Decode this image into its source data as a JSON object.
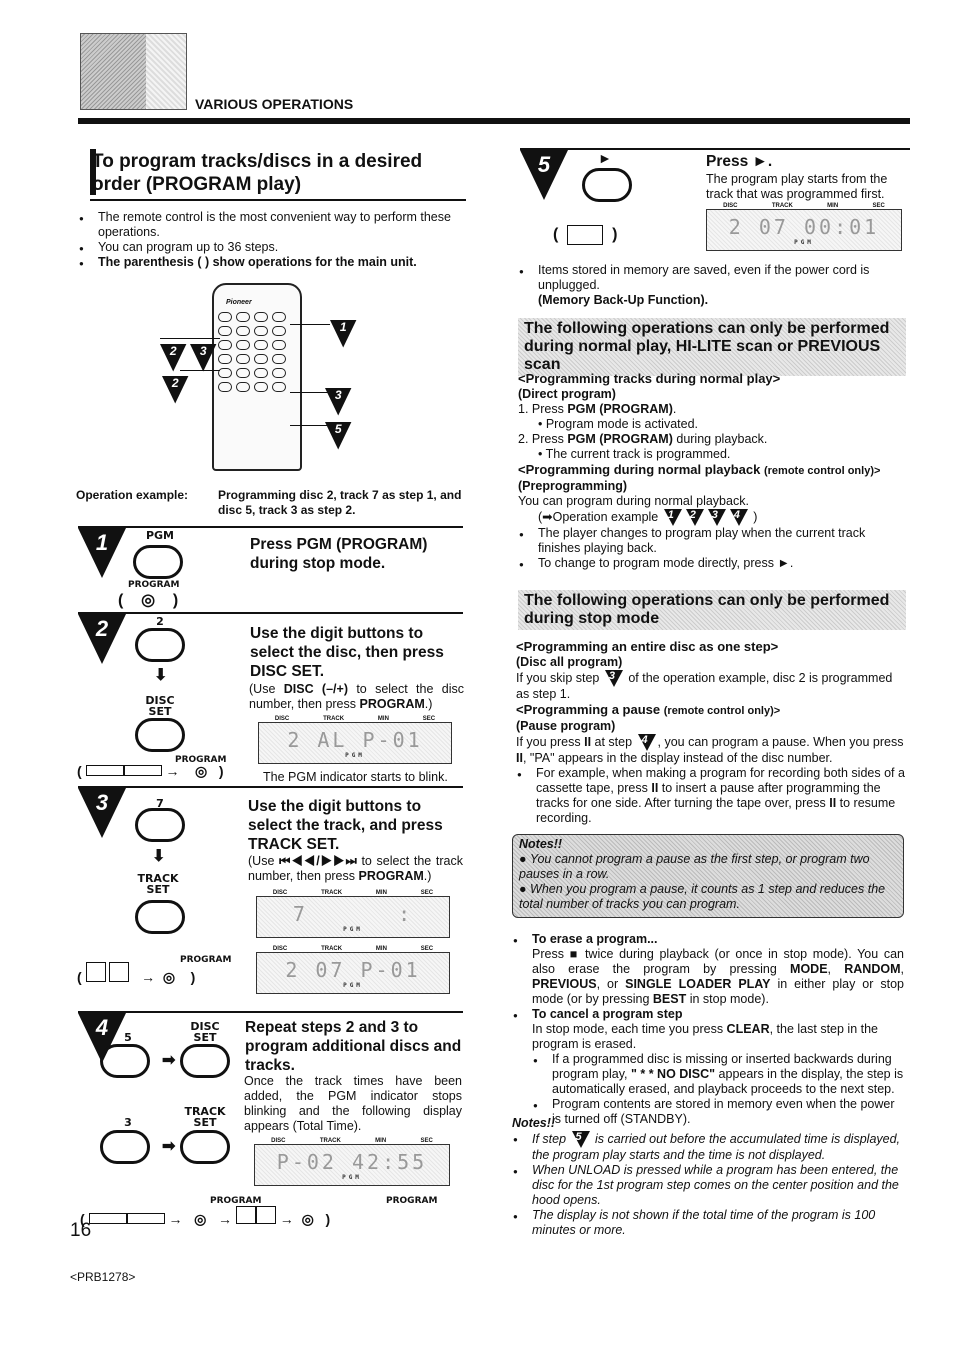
{
  "header": {
    "section": "VARIOUS OPERATIONS"
  },
  "title": {
    "line1": "To program tracks/discs in a desired",
    "line2": "order (PROGRAM play)"
  },
  "intro": [
    "The remote control is the most convenient way to perform these operations.",
    "You can program up to 36 steps.",
    "The parenthesis (   ) show operations for the main unit."
  ],
  "remote": {
    "brand": "Pioneer",
    "step_markers": [
      "1",
      "2",
      "3",
      "2",
      "3",
      "5"
    ]
  },
  "operation_example": {
    "label": "Operation example:",
    "text": "Programming disc 2, track 7 as step 1, and disc 5, track 3 as step 2."
  },
  "step1": {
    "num": "1",
    "key": "PGM",
    "unit_key": "PROGRAM",
    "heading": "Press PGM (PROGRAM) during stop mode."
  },
  "step2": {
    "num": "2",
    "digit": "2",
    "set_key": "DISC SET",
    "disc_key": "DISC",
    "unit_key": "PROGRAM",
    "heading": "Use the digit buttons to select the disc, then press DISC SET.",
    "note": [
      {
        "t": "(Use "
      },
      {
        "t": "DISC (–/+)",
        "b": 1
      },
      {
        "t": " to select the disc number, then press "
      },
      {
        "t": "PROGRAM",
        "b": 1
      },
      {
        "t": ".)"
      }
    ],
    "display": {
      "labels": [
        "DISC",
        "TRACK",
        "MIN",
        "SEC"
      ],
      "text": "2 AL  P-01",
      "indicator": "PGM"
    },
    "caption": "The PGM indicator starts to blink."
  },
  "step3": {
    "num": "3",
    "digit": "7",
    "set_key": "TRACK SET",
    "unit_key": "PROGRAM",
    "heading": "Use the digit buttons to select the track, and press TRACK SET.",
    "note": [
      {
        "t": "(Use "
      },
      {
        "t": "⏮◀◀/▶▶⏭",
        "b": 1
      },
      {
        "t": " to select the track number, then press "
      },
      {
        "t": "PROGRAM",
        "b": 1
      },
      {
        "t": ".)"
      }
    ],
    "display1": {
      "labels": [
        "DISC",
        "TRACK",
        "MIN",
        "SEC"
      ],
      "text": "7      :",
      "indicator": "PGM"
    },
    "display2": {
      "labels": [
        "DISC",
        "TRACK",
        "MIN",
        "SEC"
      ],
      "text": "2 07  P-01",
      "indicator": "PGM"
    }
  },
  "step4": {
    "num": "4",
    "digit1": "5",
    "digit2": "3",
    "disc_set": "DISC SET",
    "track_set": "TRACK SET",
    "unit_key1": "PROGRAM",
    "unit_key2": "PROGRAM",
    "heading": "Repeat steps 2 and 3 to program additional discs and tracks.",
    "note": "Once the track times have been added, the PGM indicator stops blinking and the following display appears (Total Time).",
    "display": {
      "labels": [
        "DISC",
        "TRACK",
        "MIN",
        "SEC"
      ],
      "text": "P-02 42:55",
      "indicator": "PGM"
    }
  },
  "step5": {
    "num": "5",
    "heading": "Press ►.",
    "note": "The program play starts from the track that was programmed first.",
    "display": {
      "labels": [
        "DISC",
        "TRACK",
        "MIN",
        "SEC"
      ],
      "text": "2 07 00:01",
      "indicator": "PGM"
    }
  },
  "memory": {
    "text": "Items stored in memory are saved, even if the power cord is unplugged.",
    "sub": "(Memory Back-Up Function)."
  },
  "banner1": "The following operations can only be performed during normal play, HI-LITE scan or PREVIOUS scan",
  "normal_play": {
    "h1": "<Programming tracks during normal play>",
    "h1sub": "(Direct program)",
    "items": [
      [
        {
          "t": "1. Press "
        },
        {
          "t": "PGM (PROGRAM)",
          "b": 1
        },
        {
          "t": "."
        }
      ],
      [
        {
          "t": "•  Program mode is activated."
        }
      ],
      [
        {
          "t": "2. Press "
        },
        {
          "t": "PGM (PROGRAM)",
          "b": 1
        },
        {
          "t": " during playback."
        }
      ],
      [
        {
          "t": "•  The current track is programmed."
        }
      ]
    ],
    "h2": "<Programming during normal playback ",
    "h2small": "(remote control only)>",
    "h2sub": "(Preprogramming)",
    "pre_text": "You can program during normal playback.",
    "pre_example": "(➡Operation example",
    "pre_steps": [
      "1",
      "2",
      "3",
      "4"
    ],
    "pre_bullets": [
      "The player changes to program play when the current track finishes playing back.",
      "To change to program mode directly, press ►."
    ]
  },
  "banner2": "The following operations can only be performed during stop mode",
  "stop_mode": {
    "h1": "<Programming an entire disc as one step>",
    "h1sub": "(Disc all program)",
    "disc_all": [
      {
        "t": "If you skip step "
      },
      {
        "tri": "3"
      },
      {
        "t": " of the operation example, disc 2 is programmed as step 1."
      }
    ],
    "h2": "<Programming a pause ",
    "h2small": "(remote control only)>",
    "h2sub": "(Pause program)",
    "pause_text": [
      {
        "t": "If you press "
      },
      {
        "t": "II",
        "b": 1
      },
      {
        "t": " at step "
      },
      {
        "tri": "4"
      },
      {
        "t": ", you can program a pause. When you press "
      },
      {
        "t": "II",
        "b": 1
      },
      {
        "t": ", \"PA\" appears in the display instead of the disc number."
      }
    ],
    "pause_bullet": [
      {
        "t": "For example, when making a program for recording both sides of a cassette tape, press "
      },
      {
        "t": "II",
        "b": 1
      },
      {
        "t": " to insert a pause after programming the tracks for one side. After turning the tape over, press "
      },
      {
        "t": "II",
        "b": 1
      },
      {
        "t": " to resume recording."
      }
    ]
  },
  "notes_box": {
    "title": "Notes!!",
    "items": [
      "You cannot program a pause as the first step, or program two pauses in a row.",
      "When you program a pause, it counts as 1 step and reduces the total number of tracks you can program."
    ]
  },
  "erase": {
    "title": "To erase a program...",
    "text": [
      {
        "t": "Press ■ twice during playback (or once in stop mode). You can also erase the program by pressing "
      },
      {
        "t": "MODE",
        "b": 1
      },
      {
        "t": ", "
      },
      {
        "t": "RANDOM",
        "b": 1
      },
      {
        "t": ", "
      },
      {
        "t": "PREVIOUS",
        "b": 1
      },
      {
        "t": ", or "
      },
      {
        "t": "SINGLE LOADER PLAY",
        "b": 1
      },
      {
        "t": " in either play or stop mode (or by pressing "
      },
      {
        "t": "BEST",
        "b": 1
      },
      {
        "t": " in stop mode)."
      }
    ]
  },
  "cancel": {
    "title": "To cancel a program step",
    "text": [
      {
        "t": "In stop mode, each time you press "
      },
      {
        "t": "CLEAR",
        "b": 1
      },
      {
        "t": ", the last step in the program is erased."
      }
    ],
    "sub": [
      [
        {
          "t": "If a programmed disc is missing or inserted backwards during program play, "
        },
        {
          "t": "\" * * NO DISC\"",
          "b": 1
        },
        {
          "t": " appears in the display, the step is automatically erased, and playback proceeds to the next step."
        }
      ],
      [
        {
          "t": "Program contents are stored in memory even when the power is turned off (STANDBY)."
        }
      ]
    ]
  },
  "notes2": {
    "title": "Notes!!",
    "items": [
      [
        {
          "t": "If step "
        },
        {
          "tri": "5"
        },
        {
          "t": " is carried out before the accumulated time is displayed, the program play starts and the time is not displayed."
        }
      ],
      [
        {
          "t": "When UNLOAD is pressed while a program has been entered, the disc for the 1st program step comes on the center position and the hood opens."
        }
      ],
      [
        {
          "t": "The display is not shown if the total time of the program is 100 minutes or more."
        }
      ]
    ]
  },
  "footer": {
    "page": "16",
    "code": "<PRB1278>"
  }
}
